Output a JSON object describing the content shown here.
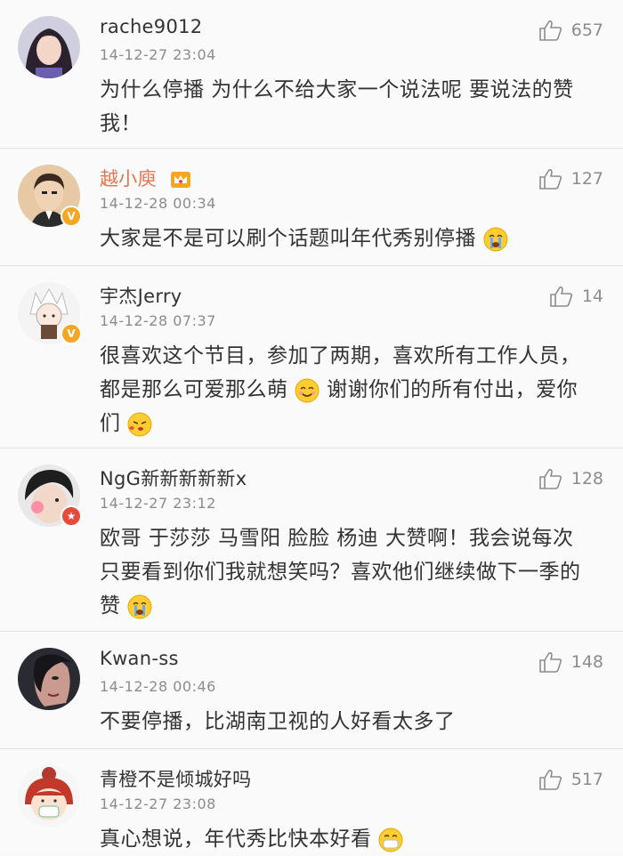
{
  "comments": [
    {
      "user": "rache9012",
      "time": "14-12-27 23:04",
      "likes": "657",
      "text": "为什么停播 为什么不给大家一个说法呢  要说法的赞我！",
      "badge": "none"
    },
    {
      "user": "越小庾",
      "time": "14-12-28 00:34",
      "likes": "127",
      "text": "大家是不是可以刷个话题叫年代秀别停播",
      "badge": "yellow-v"
    },
    {
      "user": "宇杰Jerry",
      "time": "14-12-28 07:37",
      "likes": "14",
      "text_a": "很喜欢这个节目，参加了两期，喜欢所有工作人员，都是那么可爱那么萌",
      "text_b": " 谢谢你们的所有付出，爱你们",
      "badge": "yellow-v"
    },
    {
      "user": "NgG新新新新新x",
      "time": "14-12-27 23:12",
      "likes": "128",
      "text": "欧哥 于莎莎 马雪阳 脸脸 杨迪  大赞啊！我会说每次只要看到你们我就想笑吗？喜欢他们继续做下一季的赞",
      "badge": "red-star"
    },
    {
      "user": "Kwan-ss",
      "time": "14-12-28 00:46",
      "likes": "148",
      "text": "不要停播，比湖南卫视的人好看太多了",
      "badge": "none"
    },
    {
      "user": "青橙不是倾城好吗",
      "time": "14-12-27 23:08",
      "likes": "517",
      "text": "真心想说，年代秀比快本好看",
      "badge": "none"
    }
  ],
  "icons": {
    "like": "thumbs-up-icon",
    "crown": "crown-icon"
  },
  "colors": {
    "vip_name": "#eb7350",
    "meta": "#8c8c8c",
    "text": "#333333",
    "badge_v": "#f5a623"
  }
}
